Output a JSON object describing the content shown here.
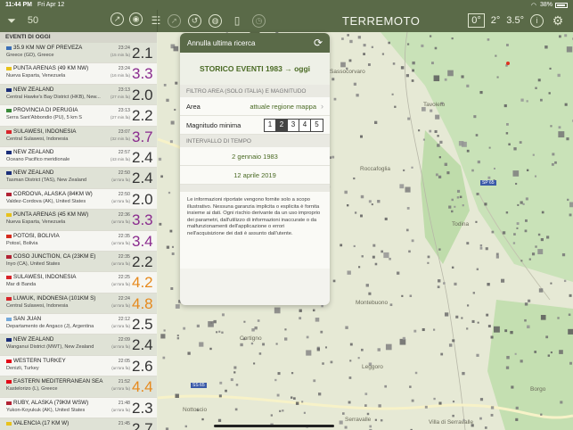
{
  "status": {
    "time": "11:44 PM",
    "date": "Fri Apr 12",
    "battery": "38%"
  },
  "toolbar": {
    "title": "TERREMOTO",
    "filter_icon": "filter-icon",
    "count_label": "50",
    "deg_box": "0°",
    "deg_small": "2°",
    "deg_mag": "3.5°"
  },
  "list": {
    "header": "EVENTI DI OGGI",
    "rows": [
      {
        "place": "35.9 KM NW OF PREVEZA",
        "region": "Greece (GD), Greece",
        "time": "23:24",
        "ago": "(15 min.fa)",
        "mag": "2.1",
        "color": "normal",
        "flag": "#3b6fb7"
      },
      {
        "place": "PUNTA ARENAS (49 KM NW)",
        "region": "Nueva Esparta, Venezuela",
        "time": "23:24",
        "ago": "(16 min.fa)",
        "mag": "3.3",
        "color": "purple",
        "flag": "#e8c21b"
      },
      {
        "place": "NEW ZEALAND",
        "region": "Central Hawke's Bay District (HKB), New...",
        "time": "23:13",
        "ago": "(27 min.fa)",
        "mag": "2.0",
        "color": "normal",
        "flag": "#1c2f7a"
      },
      {
        "place": "PROVINCIA DI PERUGIA",
        "region": "Serra Sant'Abbondio (PU), 5 km S",
        "time": "23:13",
        "ago": "(27 min.fa)",
        "mag": "2.2",
        "color": "normal",
        "flag": "#3b8a3b"
      },
      {
        "place": "SULAWESI, INDONESIA",
        "region": "Central Sulawesi, Indonesia",
        "time": "23:07",
        "ago": "(32 min.fa)",
        "mag": "3.7",
        "color": "purple",
        "flag": "#d8242a"
      },
      {
        "place": "NEW ZEALAND",
        "region": "Oceano Pacifico meridionale",
        "time": "22:57",
        "ago": "(43 min.fa)",
        "mag": "2.4",
        "color": "normal",
        "flag": "#1c2f7a"
      },
      {
        "place": "NEW ZEALAND",
        "region": "Tasman District (TAS), New Zealand",
        "time": "22:50",
        "ago": "(un'ora fa)",
        "mag": "2.4",
        "color": "normal",
        "flag": "#1c2f7a"
      },
      {
        "place": "CORDOVA, ALASKA (84KM W)",
        "region": "Valdez-Cordova (AK), United States",
        "time": "22:50",
        "ago": "(un'ora fa)",
        "mag": "2.0",
        "color": "normal",
        "flag": "#b22234"
      },
      {
        "place": "PUNTA ARENAS (45 KM NW)",
        "region": "Nueva Esparta, Venezuela",
        "time": "22:36",
        "ago": "(un'ora fa)",
        "mag": "3.3",
        "color": "purple",
        "flag": "#e8c21b"
      },
      {
        "place": "POTOSI, BOLIVIA",
        "region": "Potosí, Bolivia",
        "time": "22:35",
        "ago": "(un'ora fa)",
        "mag": "3.4",
        "color": "purple",
        "flag": "#d52b1e"
      },
      {
        "place": "COSO JUNCTION, CA (23KM E)",
        "region": "Inyo (CA), United States",
        "time": "22:35",
        "ago": "(un'ora fa)",
        "mag": "2.2",
        "color": "normal",
        "flag": "#b22234"
      },
      {
        "place": "SULAWESI, INDONESIA",
        "region": "Mar di Banda",
        "time": "22:25",
        "ago": "(un'ora fa)",
        "mag": "4.2",
        "color": "orange",
        "flag": "#d8242a"
      },
      {
        "place": "LUWUK, INDONESIA (101KM S)",
        "region": "Central Sulawesi, Indonesia",
        "time": "22:24",
        "ago": "(un'ora fa)",
        "mag": "4.8",
        "color": "orange",
        "flag": "#d8242a"
      },
      {
        "place": "SAN JUAN",
        "region": "Departamento de Angaco (J), Argentina",
        "time": "22:12",
        "ago": "(un'ora fa)",
        "mag": "2.5",
        "color": "normal",
        "flag": "#75aadb"
      },
      {
        "place": "NEW ZEALAND",
        "region": "Wanganui District (MWT), New Zealand",
        "time": "22:09",
        "ago": "(un'ora fa)",
        "mag": "2.4",
        "color": "normal",
        "flag": "#1c2f7a"
      },
      {
        "place": "WESTERN TURKEY",
        "region": "Denizli, Turkey",
        "time": "22:05",
        "ago": "(un'ora fa)",
        "mag": "2.6",
        "color": "normal",
        "flag": "#e30a17"
      },
      {
        "place": "EASTERN MEDITERRANEAN SEA",
        "region": "Kastelorizo (L), Greece",
        "time": "21:52",
        "ago": "(un'ora fa)",
        "mag": "4.4",
        "color": "orange",
        "flag": "#e30a17"
      },
      {
        "place": "RUBY, ALASKA (79KM WSW)",
        "region": "Yukon-Koyukuk (AK), United States",
        "time": "21:48",
        "ago": "(un'ora fa)",
        "mag": "2.3",
        "color": "normal",
        "flag": "#b22234"
      },
      {
        "place": "VALENCIA (17 KM W)",
        "region": "",
        "time": "21:45",
        "ago": "",
        "mag": "2.7",
        "color": "normal",
        "flag": "#e8c21b"
      }
    ]
  },
  "popover": {
    "undo_label": "Annulla ultima ricerca",
    "title": "STORICO EVENTI 1983 → oggi",
    "area_section": "FILTRO AREA (SOLO ITALIA) E MAGNITUDO",
    "area_label": "Area",
    "area_value": "attuale regione mappa",
    "magmin_label": "Magnitudo minima",
    "mag_options": [
      "1",
      "2",
      "3",
      "4",
      "5"
    ],
    "mag_selected": "2",
    "time_section": "INTERVALLO DI TEMPO",
    "date_from": "2 gennaio 1983",
    "date_to": "12 aprile 2019",
    "disclaimer": "Le informazioni riportate vengono fornite solo a scopo illustrativo. Nessuna garanzia implicita o esplicita è fornita insieme ai dati. Ogni rischio derivante da un uso improprio dei parametri, dall'utilizzo di informazioni inaccurate o da malfunzionamenti dell'applicazione o errori nell'acquisizione dei dati è assunto dall'utente."
  },
  "map": {
    "labels": [
      {
        "text": "Sassocorvaro",
        "id": "l1"
      },
      {
        "text": "Roccafoglia",
        "id": "l2"
      },
      {
        "text": "Tavoleto",
        "id": "l3"
      },
      {
        "text": "Montebuono",
        "id": "l4"
      },
      {
        "text": "Cortigno",
        "id": "l5"
      },
      {
        "text": "Leggoro",
        "id": "l6"
      },
      {
        "text": "Villa di Serravalle",
        "id": "l7"
      },
      {
        "text": "Serravalle",
        "id": "l8"
      },
      {
        "text": "Nottoscio",
        "id": "l9"
      },
      {
        "text": "SP 65",
        "id": "l10"
      },
      {
        "text": "SS 65",
        "id": "l11"
      },
      {
        "text": "Todina",
        "id": "l12"
      },
      {
        "text": "Borgo",
        "id": "l13"
      }
    ]
  },
  "colors": {
    "header": "#5a6a48",
    "accent_green": "#4a6a24",
    "orange": "#e6891c",
    "purple": "#8a2a8e"
  }
}
